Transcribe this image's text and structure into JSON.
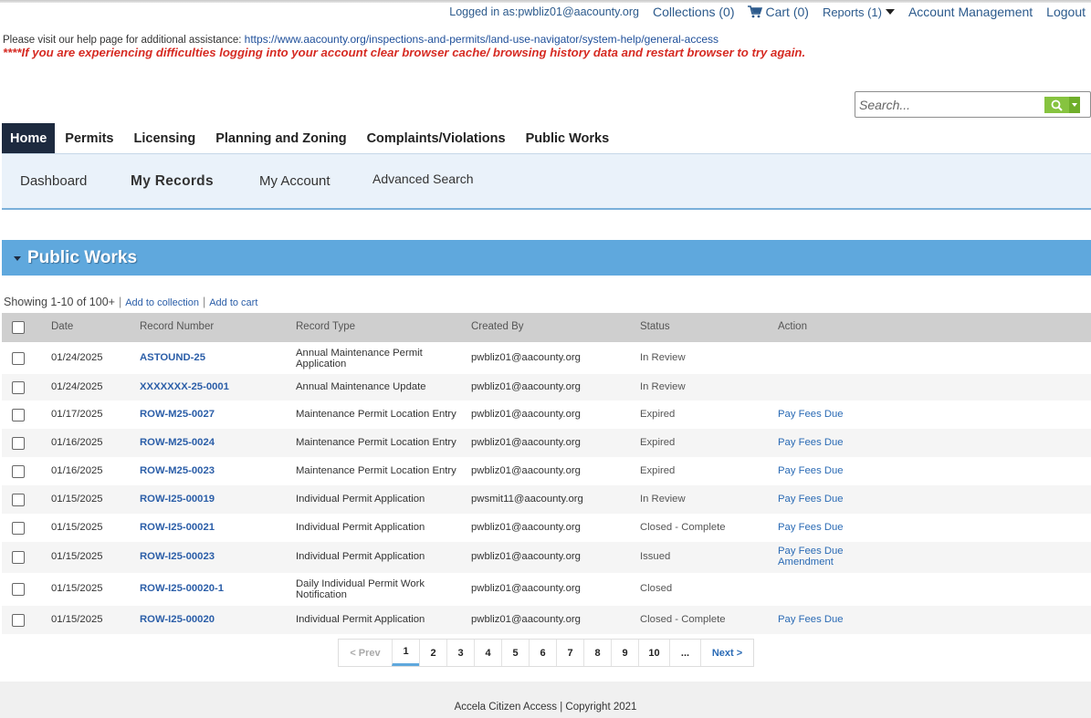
{
  "header": {
    "logged_in": "Logged in as:pwbliz01@aacounty.org",
    "collections": "Collections (0)",
    "cart": "Cart (0)",
    "reports": "Reports (1)",
    "account_management": "Account Management",
    "logout": "Logout",
    "help_text": "Please visit our help page for additional assistance: ",
    "help_link": "https://www.aacounty.org/inspections-and-permits/land-use-navigator/system-help/general-access",
    "warning": "****If you are experiencing difficulties logging into your account clear browser cache/ browsing history data and restart browser to try again."
  },
  "search": {
    "placeholder": "Search..."
  },
  "main_nav": {
    "home": "Home",
    "permits": "Permits",
    "licensing": "Licensing",
    "planning": "Planning and Zoning",
    "complaints": "Complaints/Violations",
    "public_works": "Public Works"
  },
  "sub_nav": {
    "dashboard": "Dashboard",
    "my_records": "My Records",
    "my_account": "My Account",
    "advanced_search": "Advanced Search"
  },
  "section": {
    "title": "Public Works"
  },
  "listing": {
    "showing": "Showing 1-10 of 100+",
    "separator": "|",
    "add_to_collection": "Add to collection",
    "add_to_cart": "Add to cart"
  },
  "table": {
    "headers": {
      "date": "Date",
      "record_number": "Record Number",
      "record_type": "Record Type",
      "created_by": "Created By",
      "status": "Status",
      "action": "Action"
    },
    "rows": [
      {
        "date": "01/24/2025",
        "record": "ASTOUND-25",
        "type": "Annual Maintenance Permit Application",
        "created_by": "pwbliz01@aacounty.org",
        "status": "In Review",
        "action": "",
        "action2": ""
      },
      {
        "date": "01/24/2025",
        "record": "XXXXXXX-25-0001",
        "type": "Annual Maintenance Update",
        "created_by": "pwbliz01@aacounty.org",
        "status": "In Review",
        "action": "",
        "action2": ""
      },
      {
        "date": "01/17/2025",
        "record": "ROW-M25-0027",
        "type": "Maintenance Permit Location Entry",
        "created_by": "pwbliz01@aacounty.org",
        "status": "Expired",
        "action": "Pay Fees Due",
        "action2": ""
      },
      {
        "date": "01/16/2025",
        "record": "ROW-M25-0024",
        "type": "Maintenance Permit Location Entry",
        "created_by": "pwbliz01@aacounty.org",
        "status": "Expired",
        "action": "Pay Fees Due",
        "action2": ""
      },
      {
        "date": "01/16/2025",
        "record": "ROW-M25-0023",
        "type": "Maintenance Permit Location Entry",
        "created_by": "pwbliz01@aacounty.org",
        "status": "Expired",
        "action": "Pay Fees Due",
        "action2": ""
      },
      {
        "date": "01/15/2025",
        "record": "ROW-I25-00019",
        "type": "Individual Permit Application",
        "created_by": "pwsmit11@aacounty.org",
        "status": "In Review",
        "action": "Pay Fees Due",
        "action2": ""
      },
      {
        "date": "01/15/2025",
        "record": "ROW-I25-00021",
        "type": "Individual Permit Application",
        "created_by": "pwbliz01@aacounty.org",
        "status": "Closed - Complete",
        "action": "Pay Fees Due",
        "action2": ""
      },
      {
        "date": "01/15/2025",
        "record": "ROW-I25-00023",
        "type": "Individual Permit Application",
        "created_by": "pwbliz01@aacounty.org",
        "status": "Issued",
        "action": "Pay Fees Due",
        "action2": "Amendment"
      },
      {
        "date": "01/15/2025",
        "record": "ROW-I25-00020-1",
        "type": "Daily Individual Permit Work Notification",
        "created_by": "pwbliz01@aacounty.org",
        "status": "Closed",
        "action": "",
        "action2": ""
      },
      {
        "date": "01/15/2025",
        "record": "ROW-I25-00020",
        "type": "Individual Permit Application",
        "created_by": "pwbliz01@aacounty.org",
        "status": "Closed - Complete",
        "action": "Pay Fees Due",
        "action2": ""
      }
    ]
  },
  "pagination": {
    "prev": "< Prev",
    "pages": [
      "1",
      "2",
      "3",
      "4",
      "5",
      "6",
      "7",
      "8",
      "9",
      "10"
    ],
    "ellipsis": "...",
    "next": "Next >",
    "current": "1"
  },
  "footer": {
    "text": "Accela Citizen Access | Copyright 2021"
  },
  "colors": {
    "nav_active": "#1d2a3f",
    "section_bar": "#5fa8dd",
    "link": "#2b5ea8",
    "warning": "#d62b23",
    "search_button": "#86c33f"
  }
}
